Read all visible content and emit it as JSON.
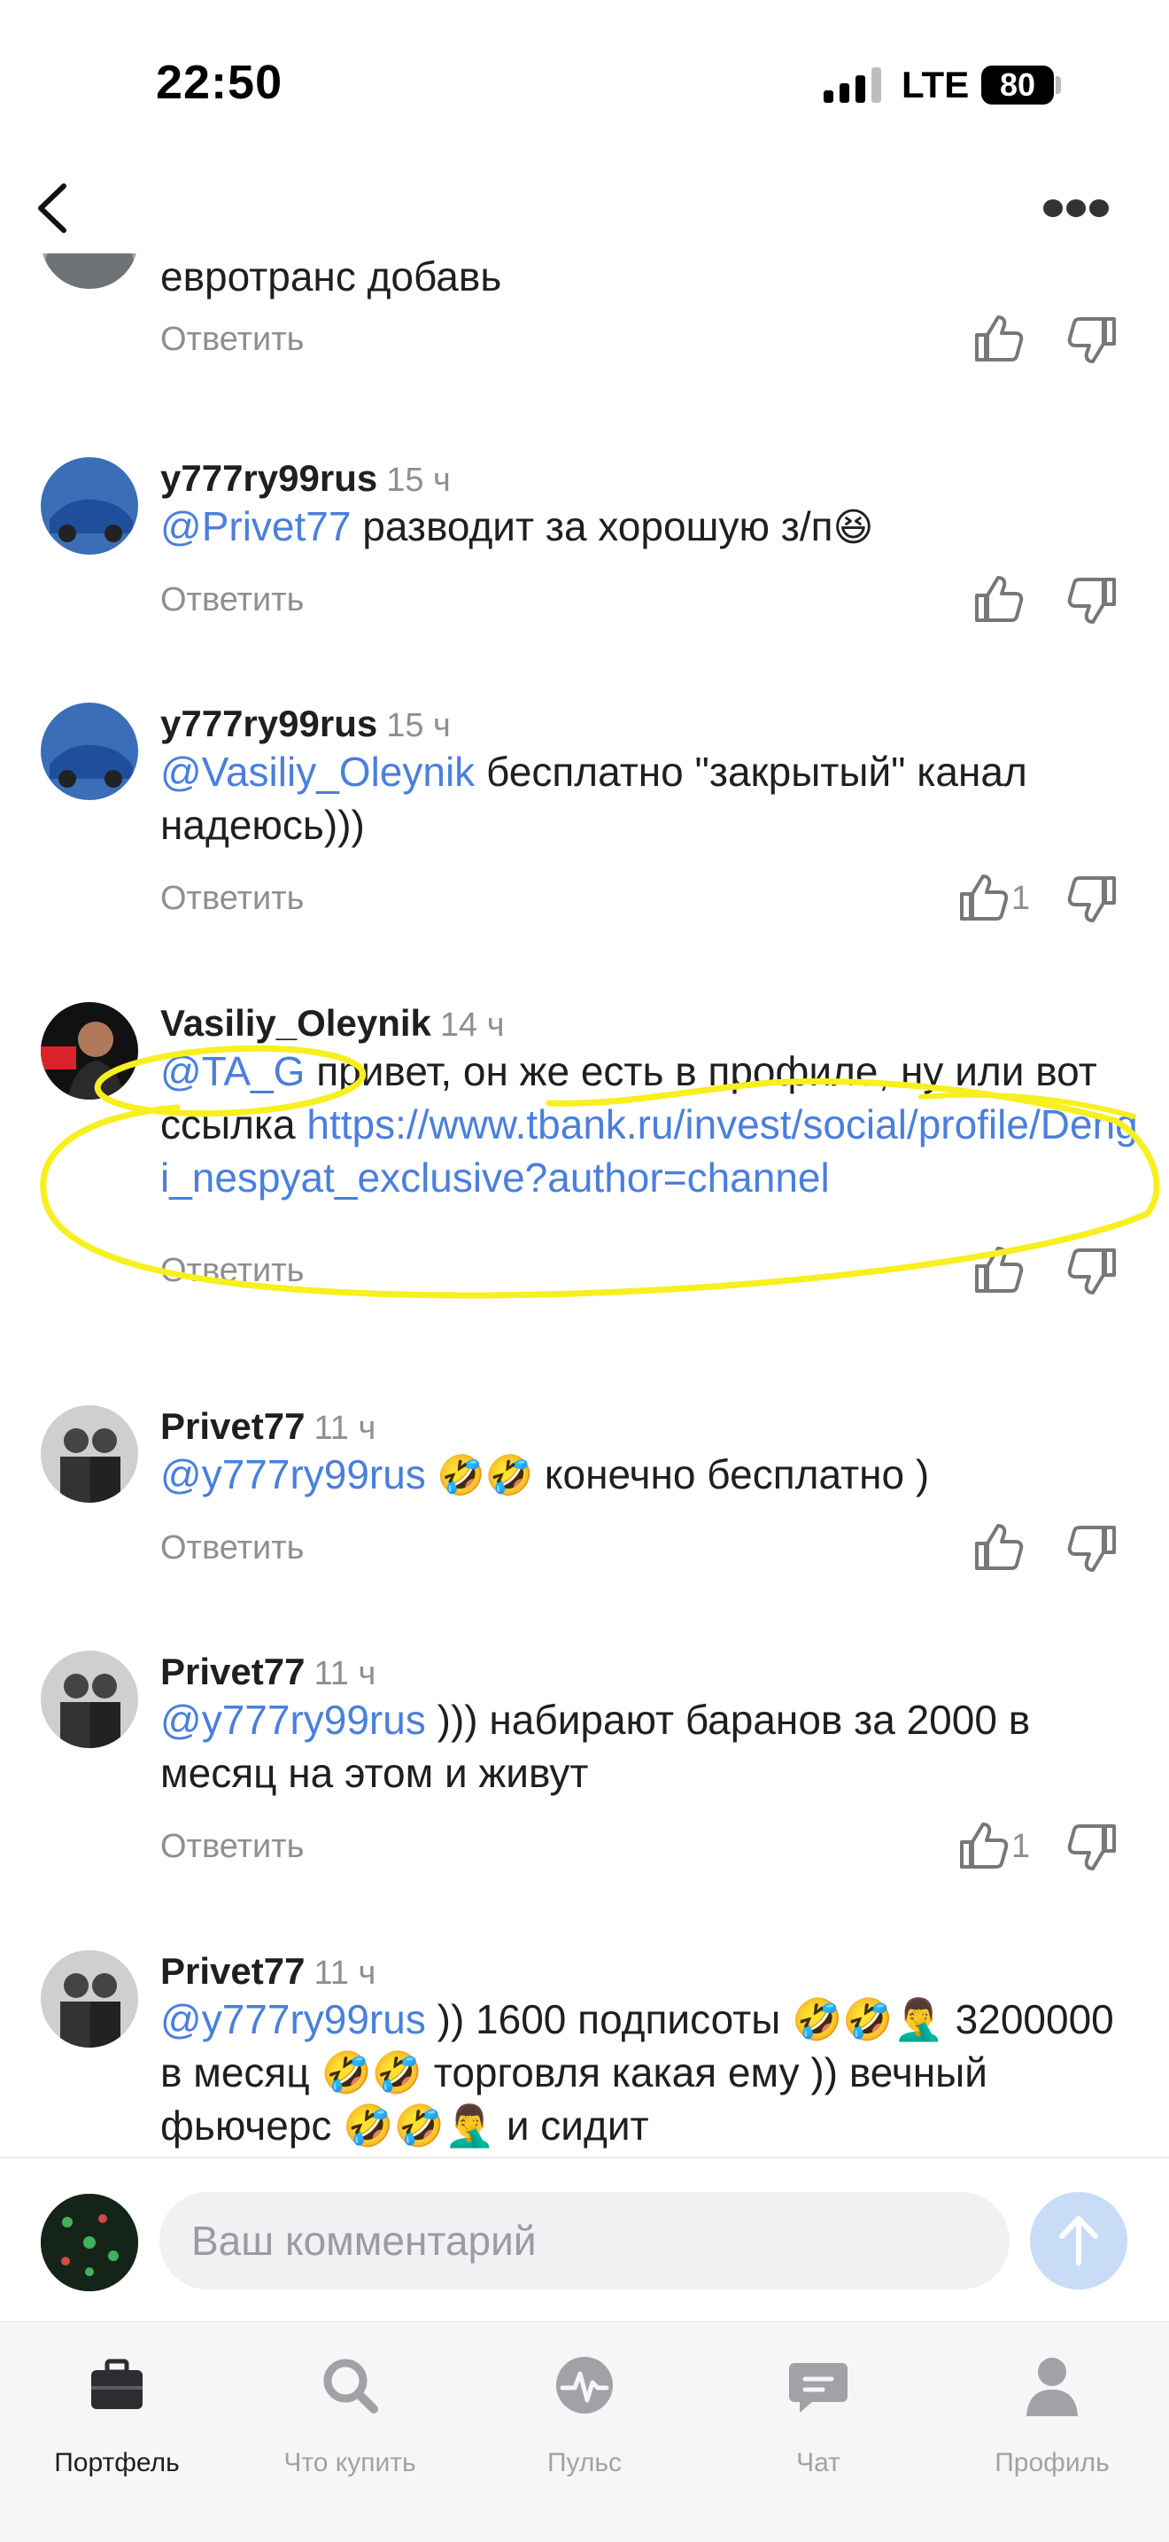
{
  "status_bar": {
    "time": "22:50",
    "network": "LTE",
    "battery": "80"
  },
  "nav": {
    "back_icon": "chevron-left-icon",
    "more_icon": "more-dots-icon"
  },
  "reply_label": "Ответить",
  "comments": [
    {
      "author": "",
      "time": "",
      "text": "евротранс добавь",
      "likes": ""
    },
    {
      "author": "y777ry99rus",
      "time": "15 ч",
      "mention": "@Privet77",
      "text": " разводит за хорошую з/п",
      "emoji": "😆",
      "likes": ""
    },
    {
      "author": "y777ry99rus",
      "time": "15 ч",
      "mention": "@Vasiliy_Oleynik",
      "text": " бесплатно \"закрытый\" канал надеюсь)))",
      "likes": "1"
    },
    {
      "author": "Vasiliy_Oleynik",
      "time": "14 ч",
      "mention": "@TA_G",
      "text": " привет, он же есть в профиле, ну или вот ссылка ",
      "link": "https://www.tbank.ru/invest/social/profile/Dengi_nespyat_exclusive?author=channel",
      "likes": ""
    },
    {
      "author": "Privet77",
      "time": "11 ч",
      "mention": "@y777ry99rus",
      "emoji": " 🤣🤣 ",
      "text": "конечно бесплатно )",
      "likes": ""
    },
    {
      "author": "Privet77",
      "time": "11 ч",
      "mention": "@y777ry99rus",
      "text": " ))) набирают баранов за 2000 в месяц на этом и живут",
      "likes": "1"
    },
    {
      "author": "Privet77",
      "time": "11 ч",
      "mention": "@y777ry99rus",
      "text": " )) 1600 подписоты 🤣🤣🤦‍♂️ 3200000 в месяц 🤣🤣 торговля какая ему )) вечный фьючерс 🤣🤣🤦‍♂️ и сидит",
      "likes": ""
    }
  ],
  "comment_input": {
    "placeholder": "Ваш комментарий"
  },
  "tabs": [
    {
      "label": "Портфель",
      "icon": "briefcase-icon",
      "active": true
    },
    {
      "label": "Что купить",
      "icon": "search-icon",
      "active": false
    },
    {
      "label": "Пульс",
      "icon": "pulse-icon",
      "active": false
    },
    {
      "label": "Чат",
      "icon": "chat-icon",
      "active": false
    },
    {
      "label": "Профиль",
      "icon": "profile-icon",
      "active": false
    }
  ],
  "colors": {
    "mention": "#4a7fdc",
    "highlight": "#f7ef1f",
    "secondary_text": "#8f8f8f"
  }
}
